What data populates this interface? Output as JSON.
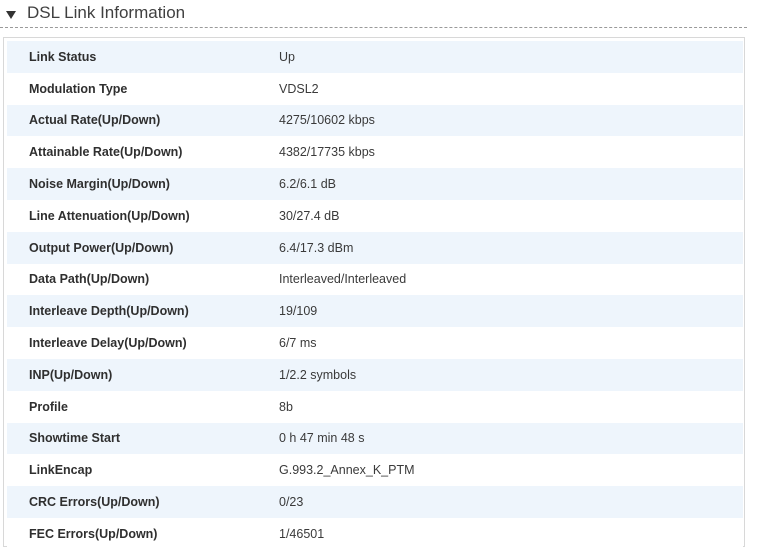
{
  "section": {
    "title": "DSL Link Information",
    "toggle_icon": "triangle-down-icon"
  },
  "rows": [
    {
      "label": "Link Status",
      "value": "Up"
    },
    {
      "label": "Modulation Type",
      "value": "VDSL2"
    },
    {
      "label": "Actual Rate(Up/Down)",
      "value": "4275/10602 kbps"
    },
    {
      "label": "Attainable Rate(Up/Down)",
      "value": "4382/17735 kbps"
    },
    {
      "label": "Noise Margin(Up/Down)",
      "value": "6.2/6.1 dB"
    },
    {
      "label": "Line Attenuation(Up/Down)",
      "value": "30/27.4 dB"
    },
    {
      "label": "Output Power(Up/Down)",
      "value": "6.4/17.3 dBm"
    },
    {
      "label": "Data Path(Up/Down)",
      "value": "Interleaved/Interleaved"
    },
    {
      "label": "Interleave Depth(Up/Down)",
      "value": "19/109"
    },
    {
      "label": "Interleave Delay(Up/Down)",
      "value": "6/7 ms"
    },
    {
      "label": "INP(Up/Down)",
      "value": "1/2.2 symbols"
    },
    {
      "label": "Profile",
      "value": "8b"
    },
    {
      "label": "Showtime Start",
      "value": "0 h 47 min 48 s"
    },
    {
      "label": "LinkEncap",
      "value": "G.993.2_Annex_K_PTM"
    },
    {
      "label": "CRC Errors(Up/Down)",
      "value": "0/23"
    },
    {
      "label": "FEC Errors(Up/Down)",
      "value": "1/46501"
    }
  ],
  "colors": {
    "row_alt": "#eef5fc",
    "border": "#d8d8d8"
  }
}
